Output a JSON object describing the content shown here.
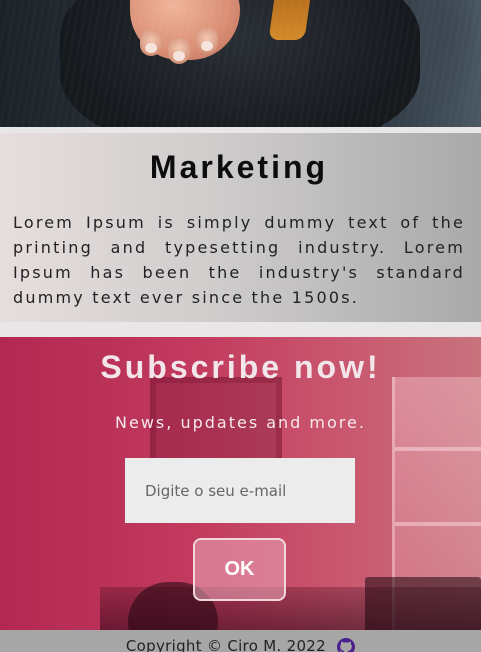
{
  "hero": {
    "image_alt": "businessman-pointing-photo"
  },
  "marketing": {
    "title": "Marketing",
    "body": "Lorem Ipsum is simply dummy text of the printing and typesetting industry. Lorem Ipsum has been the industry's standard dummy text ever since the 1500s."
  },
  "subscribe": {
    "title": "Subscribe now!",
    "tagline": "News, updates and more.",
    "email_placeholder": "Digite o seu e-mail",
    "email_value": "",
    "button_label": "OK"
  },
  "footer": {
    "copyright": "Copyright © Ciro M. 2022",
    "github_icon": "github-icon"
  },
  "colors": {
    "subscribe_bg": "#b22852",
    "footer_bg": "#a6a6a6",
    "github_icon": "#4b1f8c"
  }
}
